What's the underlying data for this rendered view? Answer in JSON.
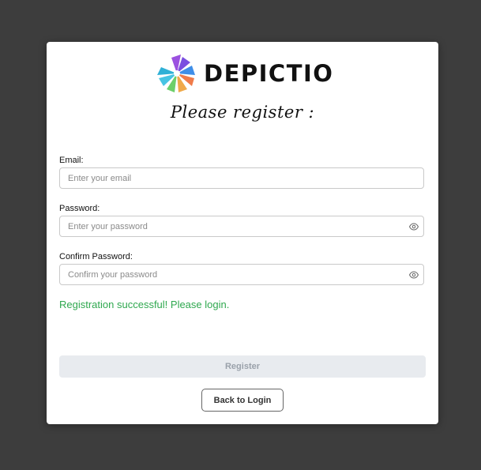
{
  "brand": {
    "name": "DEPICTIO",
    "logo_colors": [
      "#9b51e0",
      "#6e56cf",
      "#3f8ee8",
      "#47c4e3",
      "#6dcf6a",
      "#f0a94a",
      "#f07b4a"
    ]
  },
  "form": {
    "heading": "Please register :",
    "email": {
      "label": "Email:",
      "placeholder": "Enter your email",
      "value": ""
    },
    "password": {
      "label": "Password:",
      "placeholder": "Enter your password",
      "value": ""
    },
    "confirm_password": {
      "label": "Confirm Password:",
      "placeholder": "Confirm your password",
      "value": ""
    },
    "status_message": "Registration successful! Please login.",
    "status_color": "#2fa84f",
    "register_label": "Register",
    "back_label": "Back to Login"
  },
  "icons": {
    "password_toggle": "eye-icon",
    "confirm_toggle": "eye-icon"
  }
}
